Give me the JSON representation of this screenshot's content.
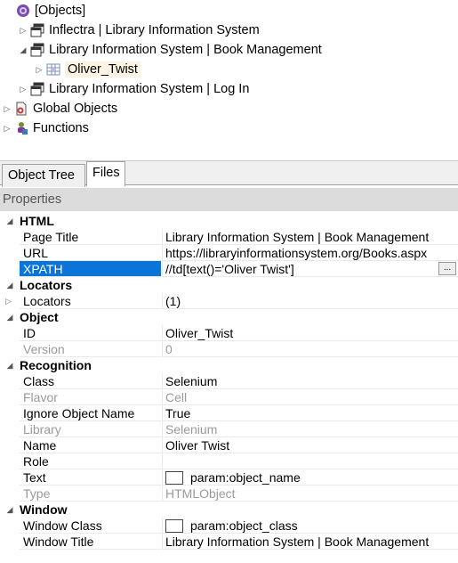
{
  "tree": {
    "root": {
      "label": "[Objects]",
      "icon": "objects-root-icon"
    },
    "items": [
      {
        "label": "Inflectra | Library Information System",
        "icon": "window-icon",
        "expanded": false
      },
      {
        "label": "Library Information System | Book Management",
        "icon": "window-icon",
        "expanded": true
      },
      {
        "label": "Oliver_Twist",
        "icon": "table-cell-icon",
        "selected": true
      },
      {
        "label": "Library Information System | Log In",
        "icon": "window-icon",
        "expanded": false
      },
      {
        "label": "Global Objects",
        "icon": "global-objects-icon"
      },
      {
        "label": "Functions",
        "icon": "functions-icon"
      }
    ]
  },
  "tabs": {
    "object_tree": "Object Tree",
    "files": "Files",
    "active": "Files"
  },
  "properties": {
    "header": "Properties",
    "html": {
      "label": "HTML",
      "page_title": {
        "name": "Page Title",
        "value": "Library Information System | Book Management"
      },
      "url": {
        "name": "URL",
        "value": "https://libraryinformationsystem.org/Books.aspx"
      },
      "xpath": {
        "name": "XPATH",
        "value": "//td[text()='Oliver Twist']",
        "button": "..."
      }
    },
    "locators": {
      "label": "Locators",
      "locators": {
        "name": "Locators",
        "value": "(1)"
      }
    },
    "object": {
      "label": "Object",
      "id": {
        "name": "ID",
        "value": "Oliver_Twist"
      },
      "version": {
        "name": "Version",
        "value": "0"
      }
    },
    "recognition": {
      "label": "Recognition",
      "class": {
        "name": "Class",
        "value": "Selenium"
      },
      "flavor": {
        "name": "Flavor",
        "value": "Cell"
      },
      "ignore_object_name": {
        "name": "Ignore Object Name",
        "value": "True"
      },
      "library": {
        "name": "Library",
        "value": "Selenium"
      },
      "name": {
        "name": "Name",
        "value": "Oliver Twist"
      },
      "role": {
        "name": "Role",
        "value": ""
      },
      "text": {
        "name": "Text",
        "value": "param:object_name"
      },
      "type": {
        "name": "Type",
        "value": "HTMLObject"
      }
    },
    "window": {
      "label": "Window",
      "window_class": {
        "name": "Window Class",
        "value": "param:object_class"
      },
      "window_title": {
        "name": "Window Title",
        "value": "Library Information System | Book Management"
      }
    }
  },
  "colors": {
    "selection": "#0a74d8",
    "tree_selected_bg": "#fdf3e3",
    "header_bg": "#dcdcdc",
    "dim_text": "#9a9a9a"
  }
}
